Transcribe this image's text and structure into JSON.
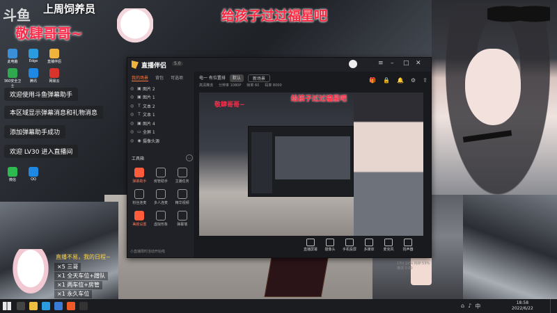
{
  "stream_overlay": {
    "logo": "斗鱼",
    "week_title": "上周饲养员",
    "thanks_text": "敬肆哥哥~",
    "banner": "给孩子过过福星吧"
  },
  "desktop_icons": [
    {
      "label": "此电脑",
      "color": "#3b8fd8"
    },
    {
      "label": "Edge",
      "color": "#2b9be0"
    },
    {
      "label": "360安全卫士",
      "color": "#2fa84f"
    },
    {
      "label": "腾讯",
      "color": "#1e88e5"
    },
    {
      "label": "直播伴侣",
      "color": "#f0b43c"
    },
    {
      "label": "网易云",
      "color": "#d9342b"
    },
    {
      "label": "微信",
      "color": "#2dbb4f"
    },
    {
      "label": "QQ",
      "color": "#1e88e5"
    }
  ],
  "chat_messages": [
    "欢迎使用斗鱼弹幕助手",
    "本区域显示弹幕消息和礼物消息",
    "添加弹幕助手成功",
    "欢迎 LV30 进入直播间"
  ],
  "gift_overlay": {
    "title": "直播不易，我的日程~",
    "items": [
      "×5 三哥",
      "×1 全天车位+蹭队",
      "×1 两车位+房管",
      "×1 永久车位"
    ]
  },
  "app": {
    "name": "直播伴侣",
    "version": "5.0",
    "left_tabs": [
      "我的场景",
      "背包",
      "可选项"
    ],
    "sources": [
      {
        "name": "图片 2",
        "icon": "image"
      },
      {
        "name": "图片 1",
        "icon": "image"
      },
      {
        "name": "文本 2",
        "icon": "text"
      },
      {
        "name": "文本 1",
        "icon": "text"
      },
      {
        "name": "图片 4",
        "icon": "image"
      },
      {
        "name": "全屏 1",
        "icon": "screen"
      },
      {
        "name": "摄像头源",
        "icon": "camera"
      }
    ],
    "tools_title": "工具箱",
    "tools": [
      {
        "label": "弹幕助手",
        "active": true
      },
      {
        "label": "房管助手",
        "active": false
      },
      {
        "label": "主播任务",
        "active": false
      },
      {
        "label": "粉丝连麦",
        "active": false
      },
      {
        "label": "多人连麦",
        "active": false
      },
      {
        "label": "精华视频",
        "active": false
      },
      {
        "label": "美颜设置",
        "active": true
      },
      {
        "label": "虚拟形象",
        "active": false
      },
      {
        "label": "弹幕墙",
        "active": false
      }
    ],
    "bottom_note": "小直播限时活动开始啦",
    "main_tabs": [
      "电一 有位置排",
      "默认",
      "新场景"
    ],
    "info_items": [
      "高清推流",
      "分辨率 1080P",
      "帧率 60",
      "码率 8000"
    ],
    "preview_banner": "给孩子过过福星吧",
    "preview_thanks": "敬肆哥哥~",
    "bottom_bar": [
      "直播屏幕",
      "摄像头",
      "手机投屏",
      "多媒体",
      "麦克风",
      "扬声器"
    ],
    "status_text": "CPU 19%  内存 53%  推流 0.00"
  },
  "taskbar": {
    "time": "18:58",
    "date": "2022/6/22",
    "tray_icons": [
      "network-icon",
      "volume-icon",
      "ime-icon"
    ],
    "pinned": [
      {
        "name": "search",
        "color": "#444"
      },
      {
        "name": "explorer",
        "color": "#f0c040"
      },
      {
        "name": "browser",
        "color": "#2b9be0"
      },
      {
        "name": "store",
        "color": "#3a7bd5"
      },
      {
        "name": "douyu",
        "color": "#f05a28"
      },
      {
        "name": "obs",
        "color": "#333"
      }
    ]
  }
}
